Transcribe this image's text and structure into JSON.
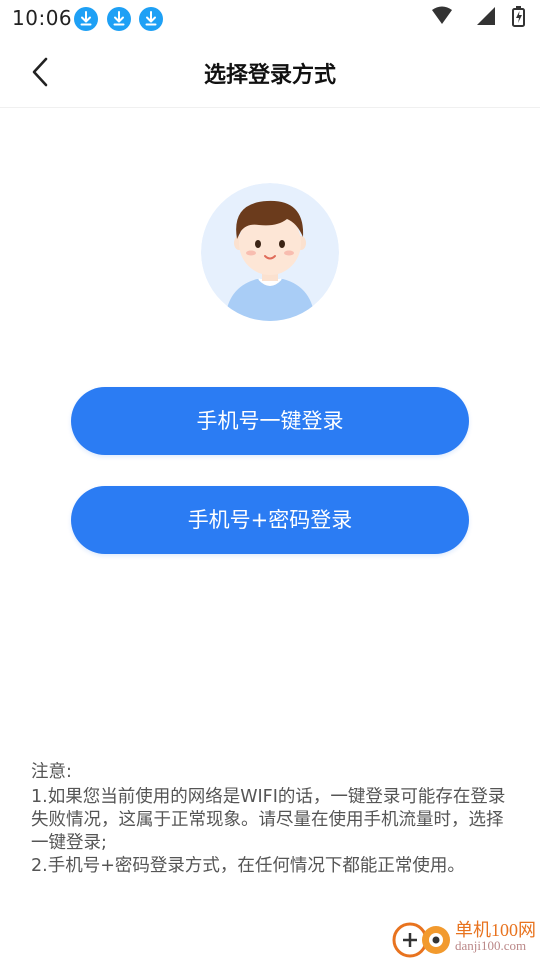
{
  "status_bar": {
    "time": "10:06",
    "icons": [
      "download-icon",
      "download-icon",
      "download-icon",
      "wifi-icon",
      "signal-icon",
      "battery-charging-icon"
    ]
  },
  "header": {
    "title": "选择登录方式",
    "back_icon": "chevron-left-icon"
  },
  "colors": {
    "primary": "#2b7cf3",
    "avatar_bg": "#e6f0fd",
    "download_badge": "#1ea0f5"
  },
  "buttons": {
    "one_click": "手机号一键登录",
    "password": "手机号+密码登录"
  },
  "notice": {
    "title": "注意:",
    "item1": " 1.如果您当前使用的网络是WIFI的话，一键登录可能存在登录失败情况，这属于正常现象。请尽量在使用手机流量时，选择一键登录;",
    "item2": " 2.手机号+密码登录方式，在任何情况下都能正常使用。"
  },
  "watermark": {
    "name": "单机100网",
    "url": "danji100.com"
  }
}
